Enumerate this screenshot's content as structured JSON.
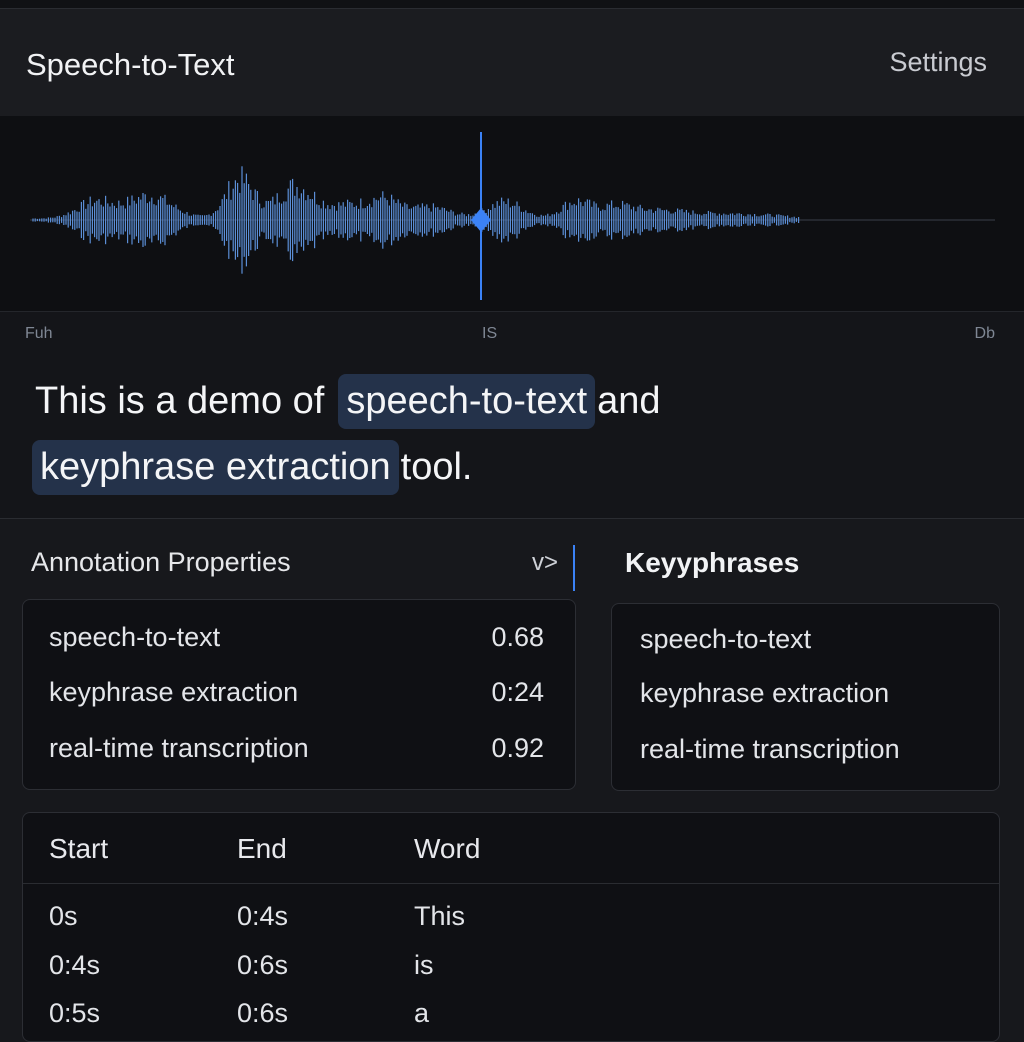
{
  "header": {
    "title": "Speech-to-Text",
    "settings_label": "Settings"
  },
  "waveform": {
    "time_labels": {
      "left": "Fuh",
      "middle": "IS",
      "right": "Db"
    },
    "colors": {
      "wave": "#5b8ed6",
      "playhead": "#3b82f6",
      "baseline": "#3a3f4a"
    },
    "playhead_position": 0.47
  },
  "transcript": {
    "line1": {
      "before": "This is a demo of",
      "keyphrase": "speech-to-text",
      "after": "and"
    },
    "line2": {
      "before": "",
      "keyphrase": "keyphrase extraction",
      "after": "tool."
    },
    "highlight_color": "#24324a"
  },
  "annotation": {
    "title": "Annotation Properties",
    "toggle_label": "v>",
    "rows": [
      {
        "name": "speech-to-text",
        "value": "0.68"
      },
      {
        "name": "keyphrase extraction",
        "value": "0:24"
      },
      {
        "name": "real-time transcription",
        "value": "0.92"
      }
    ]
  },
  "keyphrases": {
    "title": "Keyyphrases",
    "items": [
      "speech-to-text",
      "keyphrase extraction",
      "real-time transcription"
    ]
  },
  "words_table": {
    "headers": {
      "start": "Start",
      "end": "End",
      "word": "Word"
    },
    "rows": [
      {
        "start": "0s",
        "end": "0:4s",
        "word": "This"
      },
      {
        "start": "0:4s",
        "end": "0:6s",
        "word": "is"
      },
      {
        "start": "0:5s",
        "end": "0:6s",
        "word": "a"
      }
    ]
  }
}
